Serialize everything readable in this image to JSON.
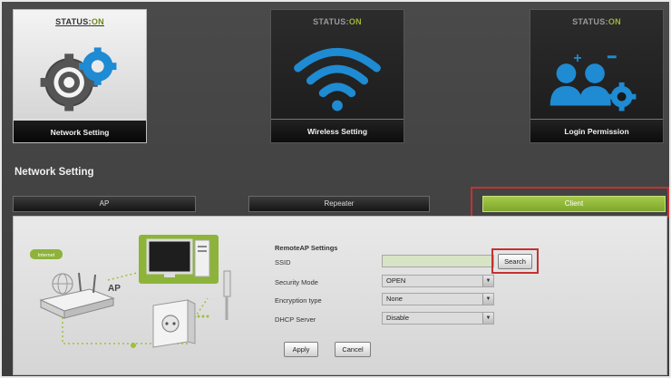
{
  "tiles": [
    {
      "status_prefix": "STATUS:",
      "status_value": "ON",
      "label": "Network Setting",
      "icon": "network-gear-icon",
      "active": true
    },
    {
      "status_prefix": "STATUS:",
      "status_value": "ON",
      "label": "Wireless Setting",
      "icon": "wifi-icon",
      "active": false
    },
    {
      "status_prefix": "STATUS:",
      "status_value": "ON",
      "label": "Login Permission",
      "icon": "users-gear-icon",
      "active": false
    }
  ],
  "section_title": "Network Setting",
  "modes": [
    {
      "label": "AP",
      "selected": false
    },
    {
      "label": "Repeater",
      "selected": false
    },
    {
      "label": "Client",
      "selected": true
    }
  ],
  "diagram": {
    "internet_label": "Internet",
    "ap_label": "AP"
  },
  "form": {
    "heading": "RemoteAP Settings",
    "ssid_label": "SSID",
    "ssid_value": "",
    "search_button": "Search",
    "security_label": "Security Mode",
    "security_value": "OPEN",
    "encryption_label": "Encryption type",
    "encryption_value": "None",
    "dhcp_label": "DHCP Server",
    "dhcp_value": "Disable",
    "apply_button": "Apply",
    "cancel_button": "Cancel"
  },
  "colors": {
    "accent_green": "#8db33a",
    "highlight_red": "#c43131",
    "field_green": "#d8e4c6"
  }
}
